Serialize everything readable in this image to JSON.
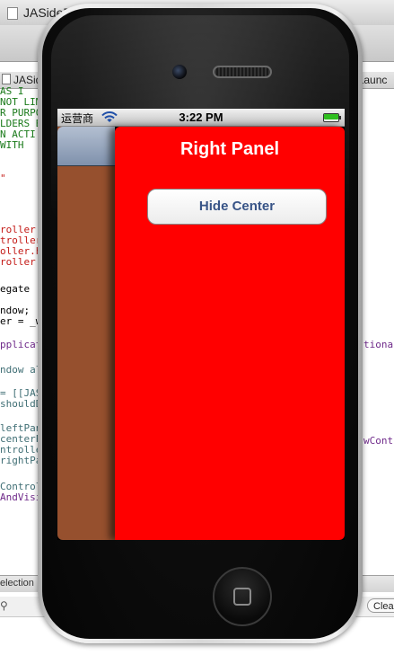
{
  "editor": {
    "window_title": "JASideP",
    "left_tab": "JASide",
    "right_tab": "hLaunc",
    "code_lines": [
      {
        "text": "  AS I",
        "color": "#1a7a1a"
      },
      {
        "text": "NOT LIM",
        "color": "#1a7a1a"
      },
      {
        "text": "R PURPO",
        "color": "#1a7a1a"
      },
      {
        "text": "LDERS B",
        "color": "#1a7a1a"
      },
      {
        "text": "N ACTI",
        "color": "#1a7a1a"
      },
      {
        "text": " WITH",
        "color": "#1a7a1a"
      },
      {
        "text": "\"",
        "color": "#c41a16"
      },
      {
        "text": "roller.",
        "color": "#c41a16"
      },
      {
        "text": "troller",
        "color": "#c41a16"
      },
      {
        "text": "oller.h",
        "color": "#c41a16"
      },
      {
        "text": "roller.",
        "color": "#c41a16"
      },
      {
        "text": "egate",
        "color": "#000000"
      },
      {
        "text": "ndow;",
        "color": "#000000"
      },
      {
        "text": "er = _w",
        "color": "#000000"
      },
      {
        "text": "pplicat",
        "color": "#6f2a8a"
      },
      {
        "text": "ndow al",
        "color": "#3f6e74"
      },
      {
        "text": "= [[JAS",
        "color": "#3f6e74"
      },
      {
        "text": "shouldD",
        "color": "#3f6e74"
      },
      {
        "text": "leftPan",
        "color": "#3f6e74"
      },
      {
        "text": "centerP",
        "color": "#3f6e74"
      },
      {
        "text": "ntrolle",
        "color": "#3f6e74"
      },
      {
        "text": "rightPa",
        "color": "#3f6e74"
      },
      {
        "text": "Control",
        "color": "#3f6e74"
      },
      {
        "text": "AndVisi",
        "color": "#6f2a8a"
      }
    ],
    "right_code": [
      "tionar",
      "wContr"
    ],
    "bottom_label": "election",
    "clear_button": "Clea"
  },
  "status_bar": {
    "carrier": "运营商",
    "time": "3:22 PM",
    "battery_level": 1.0
  },
  "right_panel": {
    "title": "Right Panel",
    "button_label": "Hide Center",
    "background_color": "#ff0000"
  },
  "left_panel": {
    "background_color": "#96502e"
  }
}
